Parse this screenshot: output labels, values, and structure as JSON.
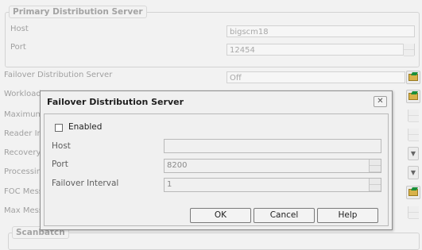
{
  "background": {
    "group_title": "Primary Distribution Server",
    "host_label": "Host",
    "host_value": "bigscm18",
    "port_label": "Port",
    "port_value": "12454",
    "rows": {
      "failover_label": "Failover Distribution Server",
      "failover_value": "Off",
      "workload_label": "Workload C",
      "maximum_label": "Maximum",
      "reader_label": "Reader In",
      "recovery_label": "Recovery",
      "processing_label": "Processin",
      "foc_label": "FOC Mess",
      "maxmess_label": "Max Mess"
    },
    "bottom_group_title": "Scanbatch"
  },
  "dialog": {
    "title": "Failover Distribution Server",
    "close_glyph": "✕",
    "enabled_label": "Enabled",
    "enabled_checked": false,
    "host_label": "Host",
    "host_value": "",
    "port_label": "Port",
    "port_value": "8200",
    "interval_label": "Failover Interval",
    "interval_value": "1",
    "ok_label": "OK",
    "cancel_label": "Cancel",
    "help_label": "Help"
  },
  "icons": {
    "browse": "folder-open-icon",
    "dropdown": "chevron-down-icon",
    "spinner": "spinner-icon",
    "close": "close-icon"
  }
}
